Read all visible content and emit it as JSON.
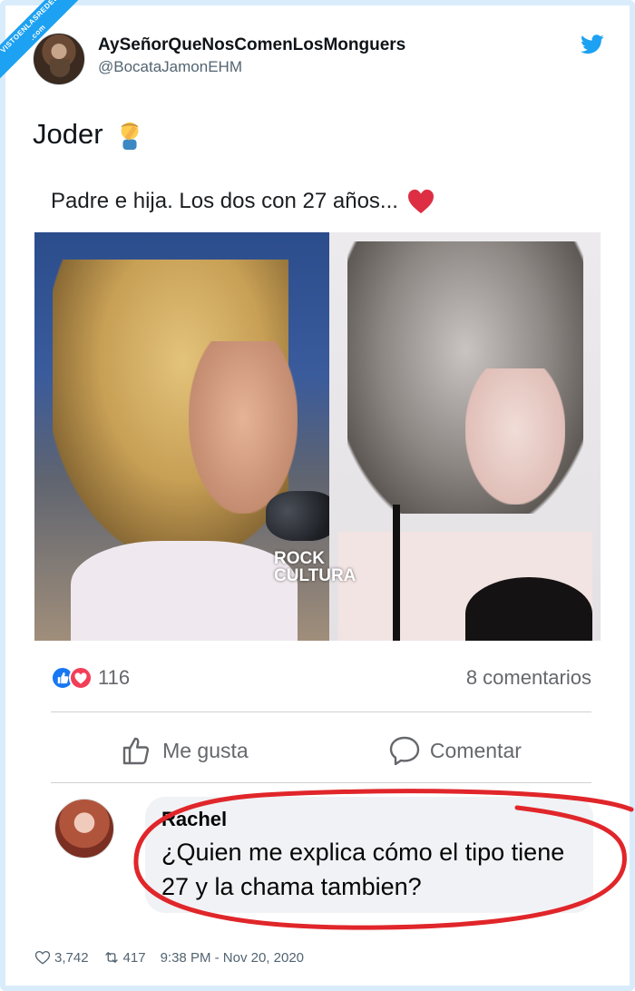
{
  "ribbon": {
    "line1": "VISTOENLASREDES",
    "line2": ".com"
  },
  "tweet": {
    "display_name": "AySeñorQueNosComenLosMonguers",
    "handle": "@BocataJamonEHM",
    "text": "Joder",
    "likes": "3,742",
    "retweets": "417",
    "timestamp": "9:38 PM - Nov 20, 2020"
  },
  "facebook_post": {
    "text": "Padre e hija. Los dos con 27 años...",
    "watermark_line1": "ROCK",
    "watermark_line2": "CULTURA",
    "reactions_count": "116",
    "comments_count": "8 comentarios",
    "like_label": "Me gusta",
    "comment_label": "Comentar"
  },
  "comment": {
    "author": "Rachel",
    "body": "¿Quien me explica cómo el tipo tiene 27 y la chama tambien?"
  },
  "colors": {
    "twitter_blue": "#1da1f2",
    "facebook_blue": "#1877f2",
    "love_red": "#f33e58",
    "annotation_red": "#e0262a"
  }
}
